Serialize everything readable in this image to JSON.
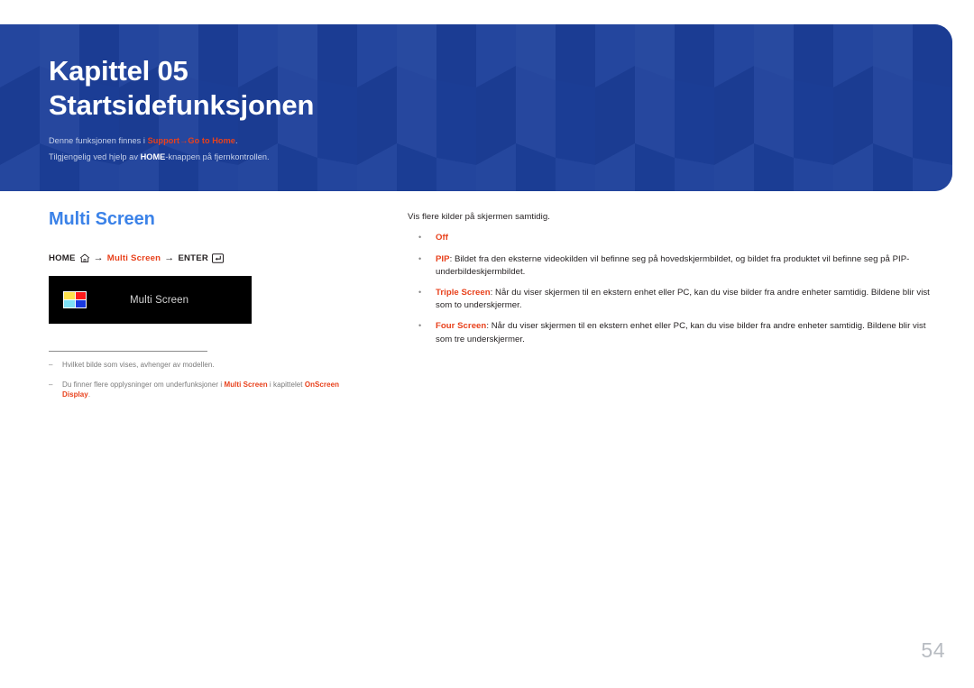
{
  "banner": {
    "chapter_label": "Kapittel 05",
    "chapter_title": "Startsidefunksjonen",
    "sub_line1_prefix": "Denne funksjonen finnes i ",
    "sub_line1_link1": "Support",
    "sub_line1_arrow": "→",
    "sub_line1_link2": "Go to Home",
    "sub_line1_suffix": ".",
    "sub_line2_prefix": "Tilgjengelig ved hjelp av ",
    "sub_line2_strong": "HOME",
    "sub_line2_suffix": "-knappen på fjernkontrollen.",
    "bg_color": "#1c3f9a",
    "accent_color": "#e8411c"
  },
  "left": {
    "section_heading": "Multi Screen",
    "heading_color": "#3b82e8",
    "nav_path": {
      "home_label": "HOME",
      "home_icon": "home-icon",
      "arrow1": "→",
      "menu_label": "Multi Screen",
      "arrow2": "→",
      "enter_label": "ENTER",
      "enter_icon": "enter-key-icon"
    },
    "osd_preview": {
      "label": "Multi Screen",
      "icon_name": "multi-screen-icon",
      "icon_colors": {
        "top_left": "#ffe14d",
        "top_right": "#ff1a1a",
        "bottom_left": "#7fe0f5",
        "bottom_right": "#1a3ae0"
      },
      "background": "#000000"
    },
    "notes": [
      {
        "dash": "–",
        "text": "Hvilket bilde som vises, avhenger av modellen."
      },
      {
        "dash": "–",
        "prefix": "Du finner flere opplysninger om underfunksjoner i ",
        "emphasis1": "Multi Screen",
        "middle": " i kapittelet ",
        "emphasis2": "OnScreen Display",
        "suffix": "."
      }
    ]
  },
  "right": {
    "intro": "Vis flere kilder på skjermen samtidig.",
    "options": [
      {
        "bullet": "•",
        "name": "Off",
        "description": ""
      },
      {
        "bullet": "•",
        "name": "PIP",
        "description": ": Bildet fra den eksterne videokilden vil befinne seg på hovedskjermbildet, og bildet fra produktet vil befinne seg på PIP-underbildeskjermbildet."
      },
      {
        "bullet": "•",
        "name": "Triple Screen",
        "description": ": Når du viser skjermen til en ekstern enhet eller PC, kan du vise bilder fra andre enheter samtidig. Bildene blir vist som to underskjermer."
      },
      {
        "bullet": "•",
        "name": "Four Screen",
        "description": ": Når du viser skjermen til en ekstern enhet eller PC, kan du vise bilder fra andre enheter samtidig. Bildene blir vist som tre underskjermer."
      }
    ]
  },
  "footer": {
    "page_number": "54"
  }
}
